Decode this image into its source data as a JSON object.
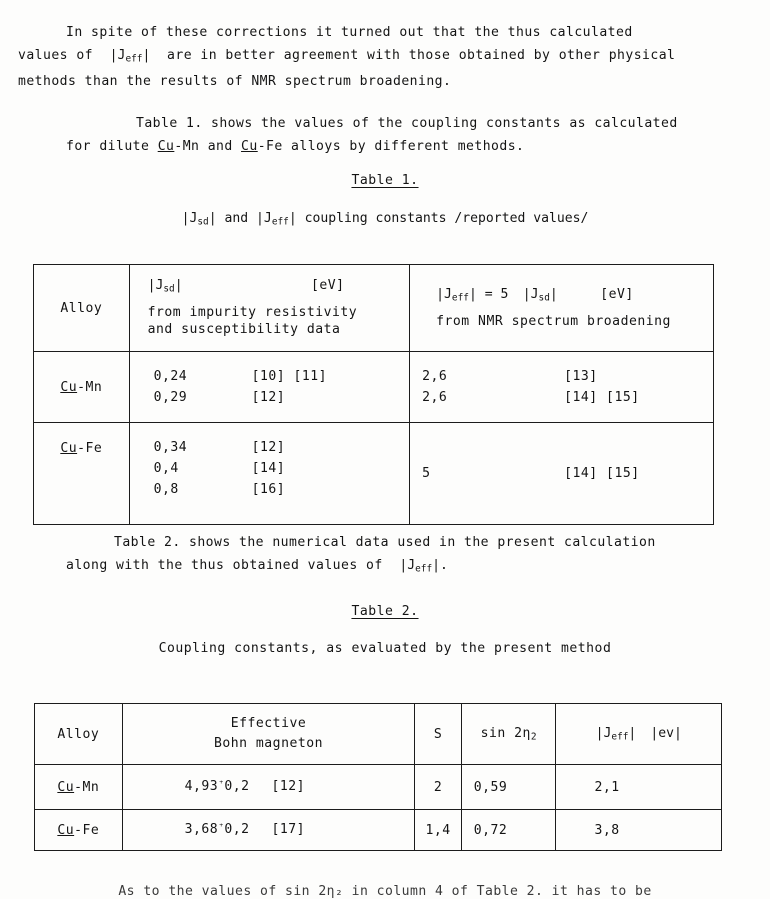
{
  "document": {
    "paragraph1": {
      "line1": "In spite of these corrections it turned out that the thus calculated",
      "line2_a": "values of",
      "line2_math": "|J",
      "line2_sub": "eff",
      "line2_math_end": "|",
      "line2_b": "are in better agreement with those obtained by other physical",
      "line3": "methods than the results of NMR spectrum broadening."
    },
    "paragraph2": {
      "line1": "Table 1. shows the values of the coupling constants as calculated",
      "line2_a": "for dilute",
      "line2_alloy1": "Cu",
      "line2_alloy1_rest": "-Mn and",
      "line2_alloy2": "Cu",
      "line2_alloy2_rest": "-Fe alloys by different methods."
    },
    "paragraph3": {
      "line1": "Table 2. shows the numerical data used in the present calculation",
      "line2_a": "along with the thus obtained values of",
      "line2_math": "|J",
      "line2_sub": "eff",
      "line2_math_end": "|."
    },
    "bottom_cropped_line": "As to the values of sin 2η₂ in column 4 of Table 2. it has to be"
  },
  "table1": {
    "title": "Table 1.",
    "caption": {
      "part1": "|J",
      "sub1": "sd",
      "part2": "| and  |J",
      "sub2": "eff",
      "part3": "|  coupling constants  /reported values/"
    },
    "headers": {
      "alloy": "Alloy",
      "col2_line1_sym": "|J",
      "col2_line1_sub": "sd",
      "col2_line1_symend": "|",
      "col2_line1_unit": "[eV]",
      "col2_line2a": "from impurity resistivity",
      "col2_line2b": "and susceptibility data",
      "col3_line1_sym": "|J",
      "col3_line1_sub": "eff",
      "col3_line1_symend": "| = 5",
      "col3_line1_sym2": "|J",
      "col3_line1_sub2": "sd",
      "col3_line1_sym2end": "|",
      "col3_line1_unit": "[eV]",
      "col3_line2": "from NMR spectrum broadening"
    },
    "rows": [
      {
        "alloy_prefix": "Cu",
        "alloy_rest": "-Mn",
        "jsd_values": [
          "0,24",
          "0,29"
        ],
        "jsd_refs": [
          "[10]  [11]",
          "[12]"
        ],
        "jeff_values": [
          "2,6",
          "2,6"
        ],
        "jeff_refs": [
          "[13]",
          "[14]   [15]"
        ]
      },
      {
        "alloy_prefix": "Cu",
        "alloy_rest": "-Fe",
        "jsd_values": [
          "0,34",
          "0,4",
          "0,8"
        ],
        "jsd_refs": [
          "[12]",
          "[14]",
          "[16]"
        ],
        "jeff_values": [
          "5"
        ],
        "jeff_refs": [
          "[14]   [15]"
        ]
      }
    ]
  },
  "table2": {
    "title": "Table 2.",
    "caption": "Coupling constants, as evaluated by the present method",
    "headers": {
      "alloy": "Alloy",
      "effective_line1": "Effective",
      "effective_line2": "Bohn magneton",
      "s": "S",
      "sin_prefix": "sin 2η",
      "sin_sub": "2",
      "jeff_sym": "|J",
      "jeff_sub": "eff",
      "jeff_symend": "|",
      "jeff_unit": "|ev|"
    },
    "rows": [
      {
        "alloy_prefix": "Cu",
        "alloy_rest": "-Mn",
        "bohn_value": "4,93",
        "bohn_pm": "⁺",
        "bohn_err": "0,2",
        "bohn_ref": "[12]",
        "s": "2",
        "sin": "0,59",
        "jeff": "2,1"
      },
      {
        "alloy_prefix": "Cu",
        "alloy_rest": "-Fe",
        "bohn_value": "3,68",
        "bohn_pm": "⁺",
        "bohn_err": "0,2",
        "bohn_ref": "[17]",
        "s": "1,4",
        "sin": "0,72",
        "jeff": "3,8"
      }
    ]
  }
}
